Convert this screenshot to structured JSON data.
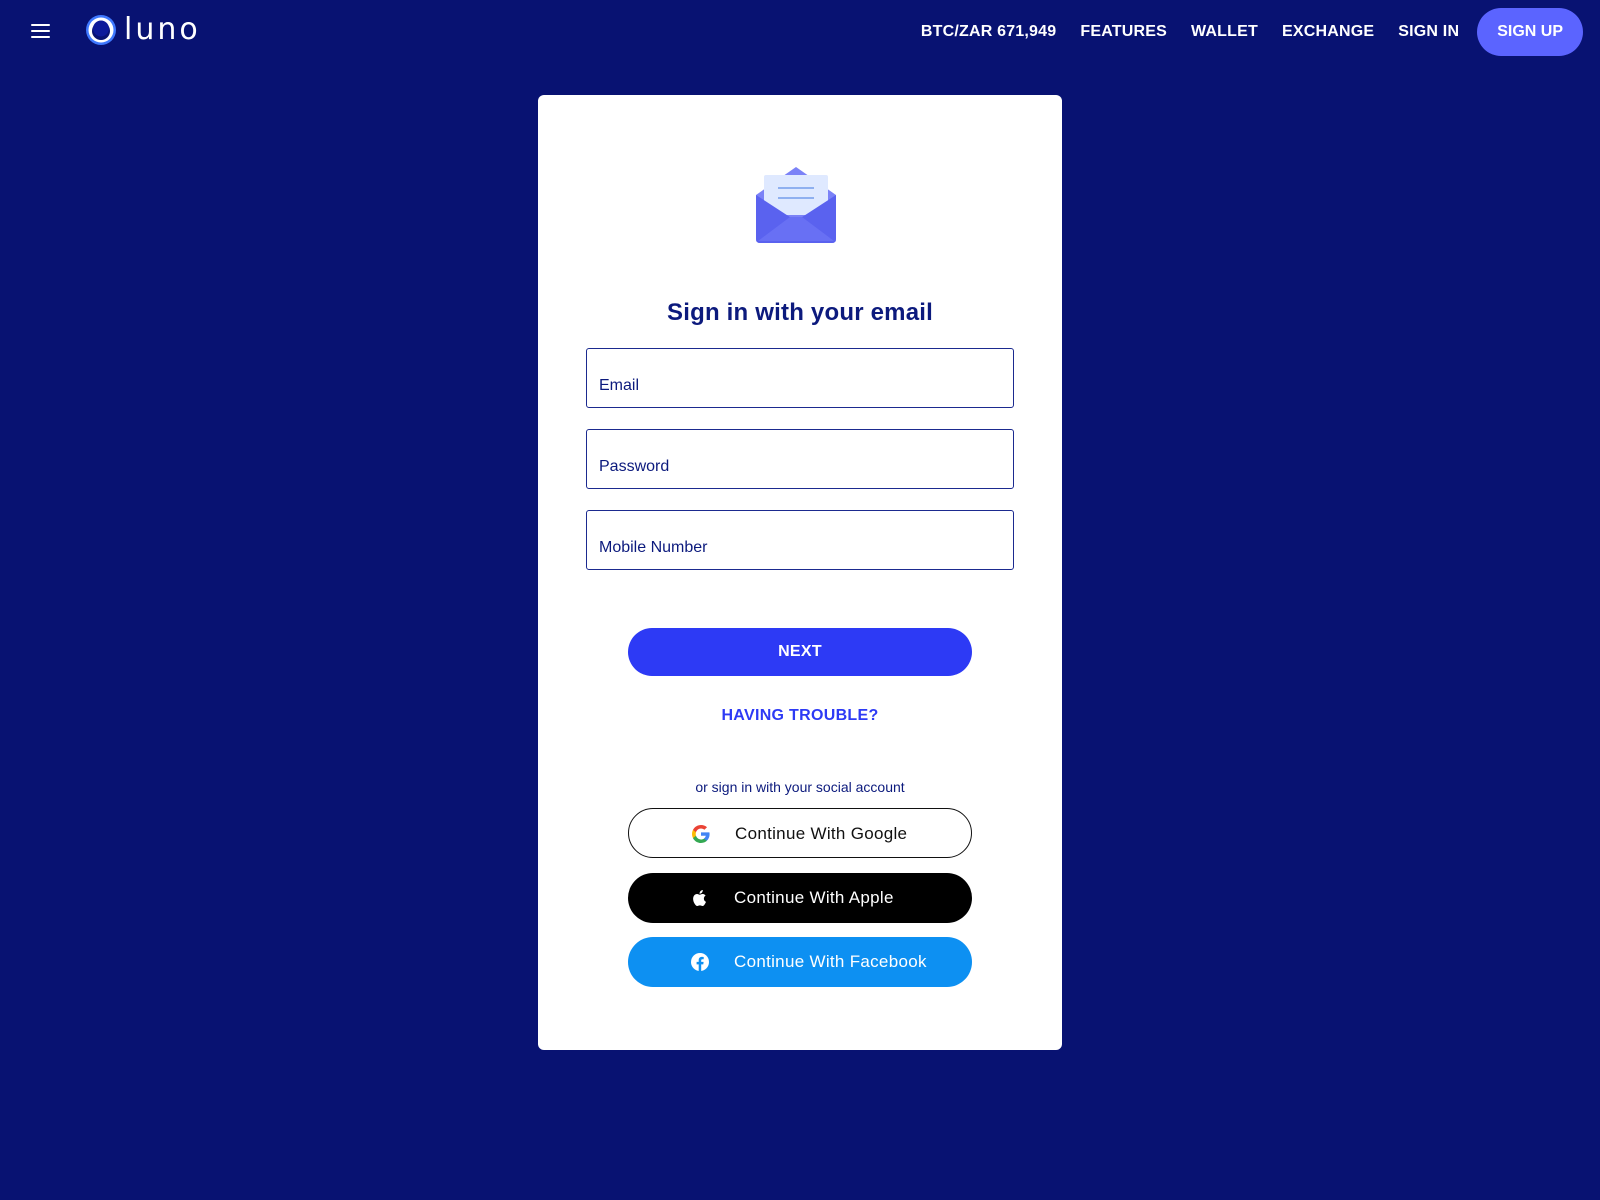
{
  "header": {
    "brand": "LUNO",
    "ticker": "BTC/ZAR 671,949",
    "nav": {
      "features": "FEATURES",
      "wallet": "WALLET",
      "exchange": "EXCHANGE",
      "sign_in": "SIGN IN",
      "sign_up": "SIGN UP"
    }
  },
  "form": {
    "icon": "open-envelope-icon",
    "title": "Sign in with your email",
    "email_placeholder": "Email",
    "password_placeholder": "Password",
    "mobile_placeholder": "Mobile Number",
    "next_label": "NEXT",
    "trouble_label": "HAVING TROUBLE?"
  },
  "social": {
    "caption": "or sign in with your social account",
    "google_label": "Continue With Google",
    "apple_label": "Continue With Apple",
    "facebook_label": "Continue With Facebook"
  },
  "colors": {
    "background": "#081272",
    "primary": "#2d3af5",
    "signup": "#5b64ff",
    "facebook": "#0d90f2",
    "title": "#0c1a7d"
  }
}
